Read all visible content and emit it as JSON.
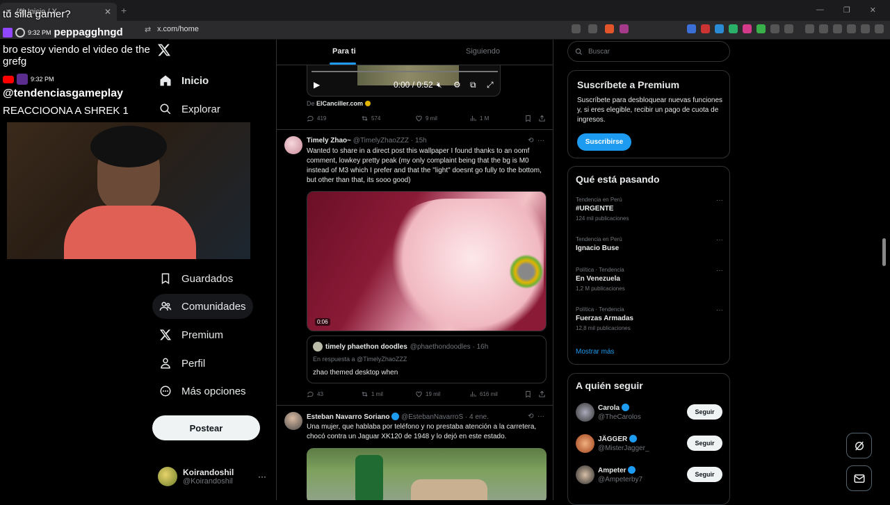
{
  "browser": {
    "tab_title": "(6) Inicio / X",
    "url": "x.com/home",
    "new_tab": "+",
    "tab_close": "✕"
  },
  "overlay": {
    "silla_text": "tú silla gamer?",
    "chat": [
      {
        "time": "9:32 PM",
        "user": "peppagghngd",
        "message": "bro estoy viendo el video de the grefg"
      },
      {
        "time": "9:32 PM",
        "user": "@tendenciasgameplay",
        "message": "REACCIOONA A SHREK 1"
      }
    ]
  },
  "nav": {
    "items": [
      {
        "label": "Inicio",
        "icon": "home-icon"
      },
      {
        "label": "Explorar",
        "icon": "search-icon"
      },
      {
        "label": "Guardados",
        "icon": "bookmark-icon"
      },
      {
        "label": "Comunidades",
        "icon": "communities-icon"
      },
      {
        "label": "Premium",
        "icon": "x-logo-icon"
      },
      {
        "label": "Perfil",
        "icon": "profile-icon"
      },
      {
        "label": "Más opciones",
        "icon": "more-circle-icon"
      }
    ],
    "post_label": "Postear",
    "account": {
      "name": "Koirandoshil",
      "handle": "@Koirandoshil",
      "more": "···"
    }
  },
  "feed": {
    "tabs": [
      {
        "label": "Para ti",
        "active": true
      },
      {
        "label": "Siguiendo",
        "active": false
      }
    ],
    "tweet1": {
      "video_time": "0:00 / 0:52",
      "from_prefix": "De",
      "from_source": "ElCanciller.com",
      "actions": {
        "replies": "419",
        "retweets": "574",
        "likes": "9 mil",
        "views": "1 M"
      }
    },
    "tweet2": {
      "name": "Timely Zhao~",
      "handle": "@TimelyZhaoZZZ · 15h",
      "text": "Wanted to share in a direct post this wallpaper I found thanks to an oomf comment, lowkey pretty peak (my only complaint being that the bg is M0 instead of M3 which I prefer and that the \"light\" doesnt go fully to the bottom, but other than that, its sooo good)",
      "media_time": "0:06",
      "quote": {
        "name": "timely phaethon doodles",
        "handle": "@phaethondoodles · 16h",
        "reply_to": "En respuesta a @TimelyZhaoZZZ",
        "text": "zhao themed desktop when"
      },
      "actions": {
        "replies": "43",
        "retweets": "1 mil",
        "likes": "19 mil",
        "views": "616 mil"
      }
    },
    "tweet3": {
      "name": "Esteban Navarro Soriano",
      "handle": "@EstebanNavarroS · 4 ene.",
      "text": "Una mujer, que hablaba por teléfono y no prestaba atención a la carretera, chocó contra un Jaguar XK120 de 1948 y lo dejó en este estado."
    }
  },
  "sidebar": {
    "search_placeholder": "Buscar",
    "premium": {
      "title": "Suscríbete a Premium",
      "desc": "Suscríbete para desbloquear nuevas funciones y, si eres elegible, recibir un pago de cuota de ingresos.",
      "button": "Suscribirse"
    },
    "trends": {
      "title": "Qué está pasando",
      "items": [
        {
          "category": "Tendencia en Perú",
          "name": "#URGENTE",
          "count": "124 mil publicaciones"
        },
        {
          "category": "Tendencia en Perú",
          "name": "Ignacio Buse",
          "count": ""
        },
        {
          "category": "Política · Tendencia",
          "name": "En Venezuela",
          "count": "1,2 M publicaciones"
        },
        {
          "category": "Política · Tendencia",
          "name": "Fuerzas Armadas",
          "count": "12,8 mil publicaciones"
        }
      ],
      "show_more": "Mostrar más"
    },
    "follow": {
      "title": "A quién seguir",
      "button": "Seguir",
      "items": [
        {
          "name": "Carola",
          "handle": "@TheCarolos"
        },
        {
          "name": "JÄGGER",
          "handle": "@MisterJagger_"
        },
        {
          "name": "Ampeter",
          "handle": "@Ampeterby7"
        }
      ]
    }
  },
  "colors": {
    "accent": "#1d9bf0",
    "background": "#000000",
    "border": "#2f3336",
    "muted": "#71767b"
  }
}
